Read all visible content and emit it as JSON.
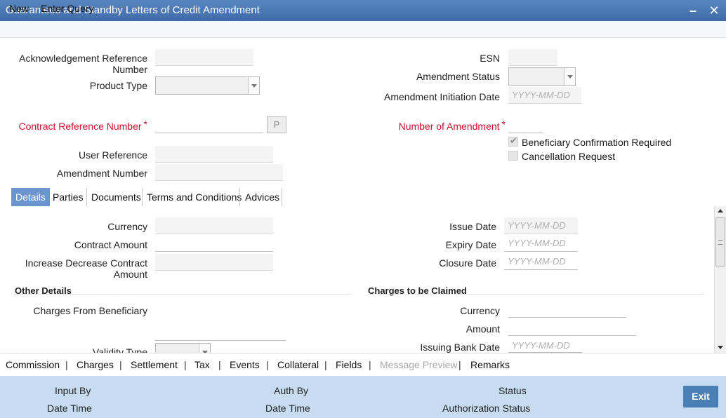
{
  "window": {
    "title": "Guarantees and Standby Letters of Credit Amendment",
    "minimize_glyph": "–",
    "close_glyph": "✕"
  },
  "menu": {
    "items": [
      "New",
      "Enter Query"
    ]
  },
  "form": {
    "ack_ref_label_line1": "Acknowledgement Reference",
    "ack_ref_label_line2": "Number",
    "product_type_label": "Product Type",
    "esn_label": "ESN",
    "amendment_status_label": "Amendment Status",
    "amendment_initiation_date_label": "Amendment Initiation Date",
    "amendment_initiation_date_placeholder": "YYYY-MM-DD",
    "contract_ref_label": "Contract Reference Number",
    "required_mark": "*",
    "p_button_label": "P",
    "number_of_amendment_label": "Number of Amendment",
    "beneficiary_confirmation_label": "Beneficiary Confirmation Required",
    "beneficiary_confirmation_checked": true,
    "cancellation_request_label": "Cancellation Request",
    "cancellation_request_checked": false,
    "user_reference_label": "User Reference",
    "amendment_number_label": "Amendment Number"
  },
  "tabs": [
    {
      "label": "Details",
      "active": true
    },
    {
      "label": "Parties",
      "active": false
    },
    {
      "label": "Documents",
      "active": false
    },
    {
      "label": "Terms and Conditions",
      "active": false
    },
    {
      "label": "Advices",
      "active": false
    }
  ],
  "details": {
    "currency_label": "Currency",
    "contract_amount_label": "Contract Amount",
    "increase_decrease_label_line1": "Increase Decrease Contract",
    "increase_decrease_label_line2": "Amount",
    "issue_date_label": "Issue Date",
    "expiry_date_label": "Expiry Date",
    "closure_date_label": "Closure Date",
    "date_placeholder": "YYYY-MM-DD",
    "other_details_heading": "Other Details",
    "charges_from_beneficiary_label": "Charges From Beneficiary",
    "validity_type_label": "Validity Type",
    "charges_to_be_claimed_heading": "Charges to be Claimed",
    "ctc_currency_label": "Currency",
    "ctc_amount_label": "Amount",
    "issuing_bank_date_label": "Issuing Bank Date"
  },
  "links": [
    {
      "label": "Commission",
      "disabled": false
    },
    {
      "label": "Charges",
      "disabled": false
    },
    {
      "label": "Settlement",
      "disabled": false
    },
    {
      "label": "Tax",
      "disabled": false
    },
    {
      "label": "Events",
      "disabled": false
    },
    {
      "label": "Collateral",
      "disabled": false
    },
    {
      "label": "Fields",
      "disabled": false
    },
    {
      "label": "Message Preview",
      "disabled": true
    },
    {
      "label": "Remarks",
      "disabled": false
    }
  ],
  "link_separator": "|",
  "footer": {
    "input_by_label": "Input By",
    "date_time_label_1": "Date Time",
    "auth_by_label": "Auth By",
    "date_time_label_2": "Date Time",
    "status_label": "Status",
    "authorization_status_label": "Authorization Status",
    "exit_label": "Exit"
  },
  "colors": {
    "title_bar": "#4a77b4",
    "active_tab": "#6b95cc",
    "required_label": "#c8102e",
    "footer_bg": "#c7dcf0",
    "exit_button": "#4a7fb5"
  }
}
